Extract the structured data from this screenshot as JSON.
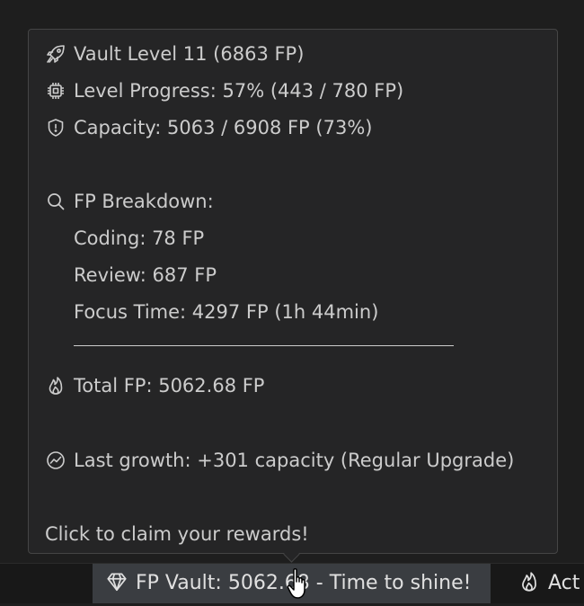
{
  "tooltip": {
    "vault_level": "Vault Level 11 (6863 FP)",
    "level_progress": "Level Progress: 57% (443 / 780 FP)",
    "capacity": "Capacity: 5063 / 6908 FP (73%)",
    "breakdown_title": "FP Breakdown:",
    "breakdown": [
      "Coding: 78 FP",
      "Review: 687 FP",
      "Focus Time: 4297 FP (1h 44min)"
    ],
    "total": "Total FP: 5062.68 FP",
    "last_growth": "Last growth: +301 capacity (Regular Upgrade)",
    "claim": "Click to claim your rewards!",
    "icons": {
      "vault_level": "rocket-icon",
      "level_progress": "chip-icon",
      "capacity": "shield-icon",
      "breakdown": "search-icon",
      "total": "flame-icon",
      "last_growth": "trend-icon"
    }
  },
  "statusbar": {
    "vault_label": "FP Vault: 5062.68 - Time to shine!",
    "vault_icon": "diamond-icon",
    "activity_label": "Act",
    "activity_icon": "flame-icon"
  },
  "colors": {
    "background": "#1e1e1e",
    "tooltip_bg": "#252526",
    "tooltip_border": "#454545",
    "text": "#cccccc",
    "statusbar_bg": "#181818",
    "statusbar_hover": "#3a3d41"
  }
}
